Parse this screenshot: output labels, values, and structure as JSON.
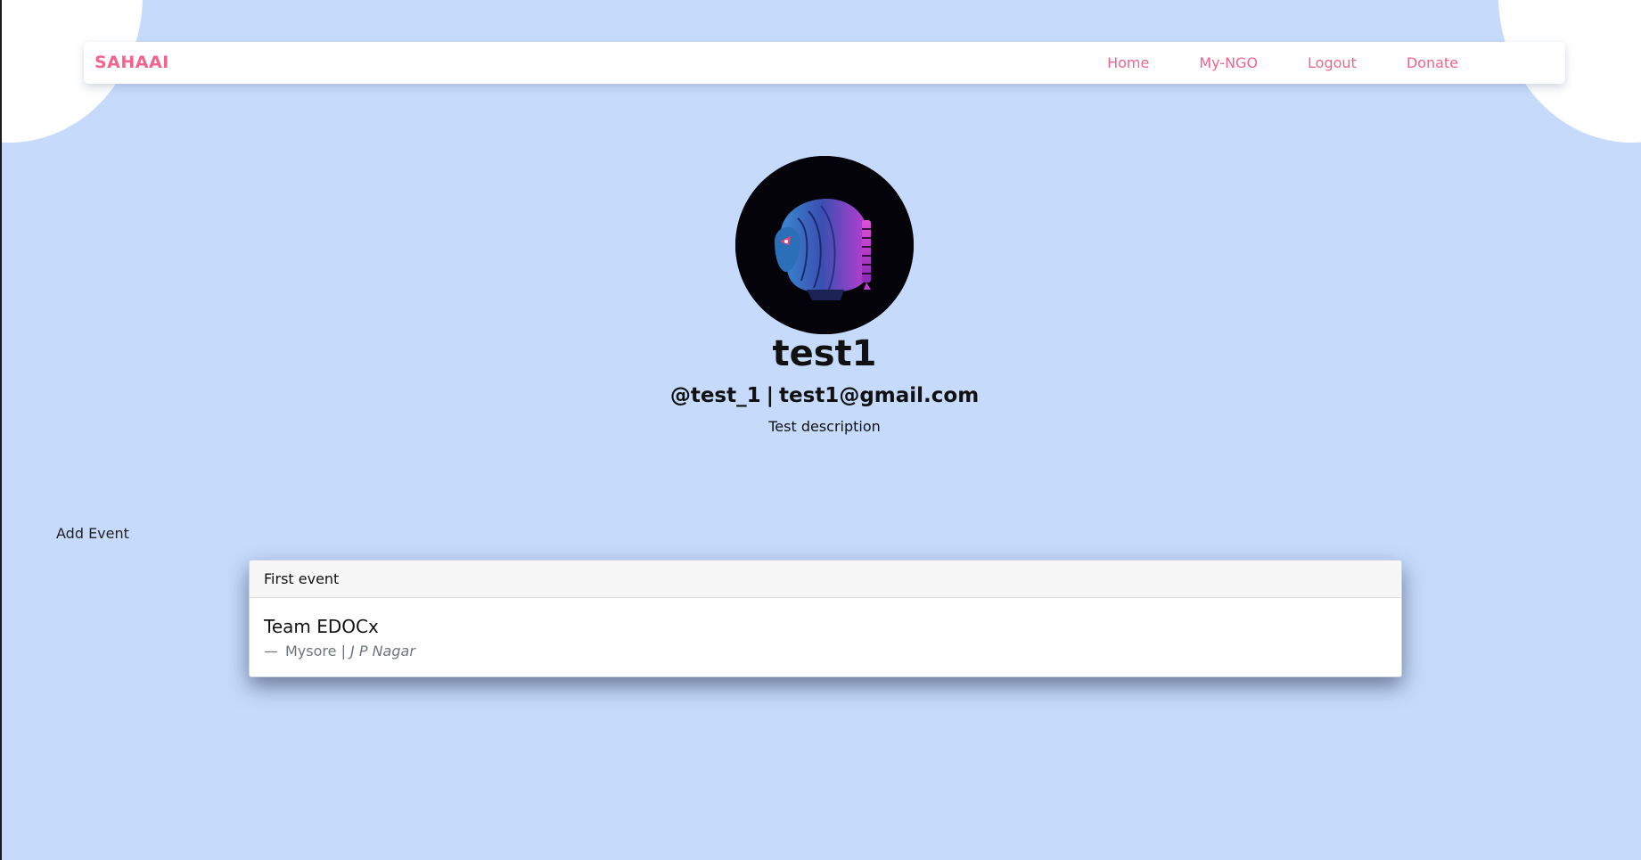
{
  "navbar": {
    "brand": "SAHAAI",
    "links": [
      "Home",
      "My-NGO",
      "Logout",
      "Donate"
    ]
  },
  "profile": {
    "avatar_icon": "astronaut-helmet-avatar",
    "name": "test1",
    "username": "@test_1",
    "separator": "|",
    "email": "test1@gmail.com",
    "description": "Test description"
  },
  "actions": {
    "add_event": "Add Event"
  },
  "events": [
    {
      "header": "First event",
      "title": "Team EDOCx",
      "dash": "—",
      "city": "Mysore",
      "separator": "|",
      "area": "J P Nagar"
    }
  ],
  "colors": {
    "background": "#c6dbfc",
    "brand": "#f2648d",
    "card": "#ffffff"
  }
}
